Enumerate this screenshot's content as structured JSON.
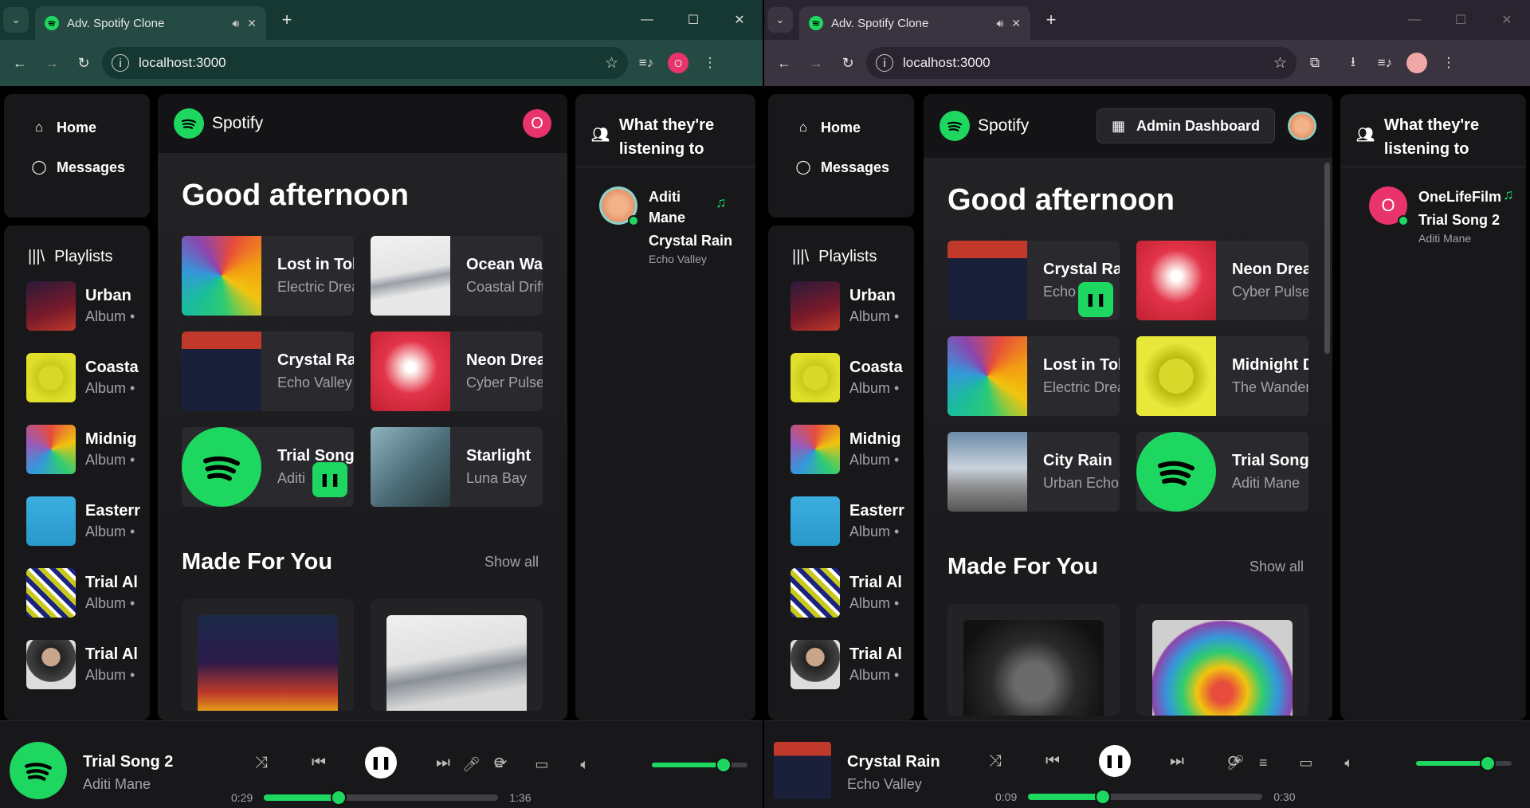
{
  "colors": {
    "accent": "#1ed760",
    "avatar_pink": "#e8336d"
  },
  "windows": [
    {
      "tab_title": "Adv. Spotify Clone",
      "url": "localhost:3000",
      "profile_initial": "O",
      "nav": {
        "home": "Home",
        "messages": "Messages"
      },
      "playlists_label": "Playlists",
      "playlists": [
        {
          "title": "Urban",
          "sub": "Album •"
        },
        {
          "title": "Coasta",
          "sub": "Album •"
        },
        {
          "title": "Midnig",
          "sub": "Album •"
        },
        {
          "title": "Easterr",
          "sub": "Album •"
        },
        {
          "title": "Trial Al",
          "sub": "Album •"
        },
        {
          "title": "Trial Al",
          "sub": "Album •"
        }
      ],
      "brand": "Spotify",
      "user_initial": "O",
      "greeting": "Good afternoon",
      "featured": [
        {
          "title": "Lost in Tok",
          "artist": "Electric Drea"
        },
        {
          "title": "Ocean Wav",
          "artist": "Coastal Drift"
        },
        {
          "title": "Crystal Rai",
          "artist": "Echo Valley"
        },
        {
          "title": "Neon Drea",
          "artist": "Cyber Pulse"
        },
        {
          "title": "Trial Song :",
          "artist": "Aditi"
        },
        {
          "title": "Starlight",
          "artist": "Luna Bay"
        }
      ],
      "section_title": "Made For You",
      "show_all": "Show all",
      "friends_title": "What they're listening to",
      "friend": {
        "name": "Aditi Mane",
        "song": "Crystal Rain",
        "artist": "Echo Valley"
      },
      "player": {
        "title": "Trial Song 2",
        "artist": "Aditi Mane",
        "elapsed": "0:29",
        "duration": "1:36",
        "progress": 0.32,
        "volume": 0.75
      }
    },
    {
      "tab_title": "Adv. Spotify Clone",
      "url": "localhost:3000",
      "nav": {
        "home": "Home",
        "messages": "Messages"
      },
      "playlists_label": "Playlists",
      "playlists": [
        {
          "title": "Urban",
          "sub": "Album •"
        },
        {
          "title": "Coasta",
          "sub": "Album •"
        },
        {
          "title": "Midnig",
          "sub": "Album •"
        },
        {
          "title": "Easterr",
          "sub": "Album •"
        },
        {
          "title": "Trial Al",
          "sub": "Album •"
        },
        {
          "title": "Trial Al",
          "sub": "Album •"
        }
      ],
      "brand": "Spotify",
      "admin_button": "Admin Dashboard",
      "greeting": "Good afternoon",
      "featured": [
        {
          "title": "Crystal Rai",
          "artist": "Echo"
        },
        {
          "title": "Neon Drea",
          "artist": "Cyber Pulse"
        },
        {
          "title": "Lost in Tok",
          "artist": "Electric Drea"
        },
        {
          "title": "Midnight D",
          "artist": "The Wandere"
        },
        {
          "title": "City Rain",
          "artist": "Urban Echo"
        },
        {
          "title": "Trial Song :",
          "artist": "Aditi Mane"
        }
      ],
      "section_title": "Made For You",
      "show_all": "Show all",
      "friends_title": "What they're listening to",
      "friend": {
        "initial": "O",
        "name": "OneLifeFilm",
        "song": "Trial Song 2",
        "artist": "Aditi Mane"
      },
      "player": {
        "title": "Crystal Rain",
        "artist": "Echo Valley",
        "elapsed": "0:09",
        "duration": "0:30",
        "progress": 0.32,
        "volume": 0.75
      }
    }
  ]
}
